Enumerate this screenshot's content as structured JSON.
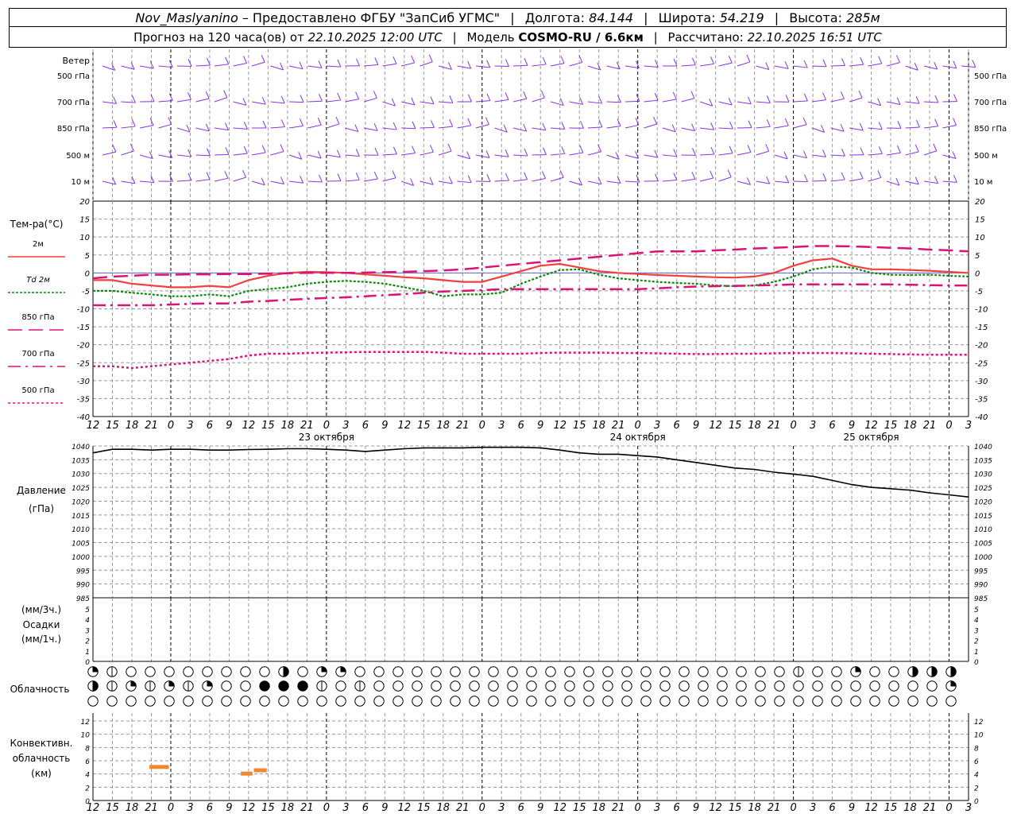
{
  "header": {
    "station": "Nov_Maslyanino",
    "provider": "– Предоставлено ФГБУ \"ЗапСиб УГМС\"",
    "lon_label": "Долгота:",
    "lon": "84.144",
    "lat_label": "Широта:",
    "lat": "54.219",
    "alt_label": "Высота:",
    "alt": "285м",
    "forecast_label": "Прогноз на 120 часа(ов) от",
    "forecast_from": "22.10.2025 12:00 UTC",
    "model_label": "Модель",
    "model": "COSMO-RU / 6.6км",
    "calc_label": "Рассчитано:",
    "calc": "22.10.2025 16:51 UTC"
  },
  "labels": {
    "wind_title": "Ветер",
    "wind_levels": [
      "500 гПа",
      "700 гПа",
      "850 гПа",
      "500 м",
      "10 м"
    ],
    "temp_title": "Тем-ра(°C)",
    "legend": [
      "2м",
      "Td  2м",
      "850 гПа",
      "700 гПа",
      "500 гПа"
    ],
    "pressure_title": "Давление",
    "pressure_unit": "(гПа)",
    "precip_unit1": "(мм/3ч.)",
    "precip_title": "Осадки",
    "precip_unit2": "(мм/1ч.)",
    "cloud_title": "Облачность",
    "conv_title1": "Конвективн.",
    "conv_title2": "облачность",
    "conv_unit": "(км)",
    "dates": [
      "23 октября",
      "24 октября",
      "25 октября"
    ]
  },
  "colors": {
    "t2m": "#f04040",
    "td2m": "#118811",
    "t850": "#dd1177",
    "t700": "#dd1177",
    "t500": "#dd1177",
    "wind": "#8833dd",
    "conv": "#ee8833",
    "grid": "#999999"
  },
  "chart_data": [
    {
      "type": "line",
      "title": "Тем-ра(°C)",
      "x_hours": [
        0,
        3,
        6,
        9,
        12,
        15,
        18,
        21,
        24,
        27,
        30,
        33,
        36,
        39,
        42,
        45,
        48,
        51,
        54,
        57,
        60,
        63,
        66,
        69,
        72,
        75,
        78,
        81,
        84,
        87,
        90,
        93,
        96,
        99,
        102,
        105,
        108,
        111,
        114,
        117,
        120,
        123,
        126,
        129,
        132,
        135
      ],
      "x_ticks": [
        "12",
        "15",
        "18",
        "21",
        "0",
        "3",
        "6",
        "9",
        "12",
        "15",
        "18",
        "21",
        "0",
        "3",
        "6",
        "9",
        "12",
        "15",
        "18",
        "21",
        "0",
        "3",
        "6",
        "9",
        "12",
        "15",
        "18"
      ],
      "ylim": [
        -40,
        20
      ],
      "series": [
        {
          "name": "2м",
          "values": [
            -2,
            -2,
            -3,
            -3.5,
            -4,
            -4,
            -3.6,
            -4,
            -2,
            -0.8,
            0,
            0.3,
            0.2,
            0,
            -0.4,
            -0.8,
            -1.2,
            -1.5,
            -2,
            -2.5,
            -2.5,
            -1,
            0.5,
            2.0,
            2.5,
            1.5,
            0.5,
            0,
            -0.3,
            -0.6,
            -0.8,
            -1,
            -1.2,
            -1.3,
            -1,
            0,
            2,
            3.5,
            4,
            2,
            1,
            1,
            0.8,
            0.6,
            0.3,
            0
          ]
        },
        {
          "name": "Td  2м",
          "values": [
            -5,
            -5,
            -5.5,
            -6,
            -6.5,
            -6.5,
            -6,
            -6.5,
            -5,
            -4.5,
            -4,
            -3,
            -2.5,
            -2.2,
            -2.5,
            -3,
            -4,
            -5,
            -6.5,
            -6,
            -6,
            -5.5,
            -3,
            -1,
            0.8,
            1,
            -0.5,
            -1.5,
            -2,
            -2.5,
            -2.8,
            -3,
            -3.5,
            -3.7,
            -3.5,
            -2.5,
            -1,
            1,
            1.8,
            1.5,
            0,
            -0.5,
            -0.6,
            -0.5,
            -0.8,
            -1
          ]
        },
        {
          "name": "850 гПа",
          "values": [
            -1.5,
            -1,
            -0.8,
            -0.5,
            -0.5,
            -0.4,
            -0.4,
            -0.3,
            -0.3,
            -0.2,
            -0.1,
            0,
            0,
            0,
            0.1,
            0.2,
            0.3,
            0.5,
            0.7,
            1.0,
            1.5,
            2,
            2.5,
            3,
            3.5,
            4,
            4.5,
            5,
            5.5,
            6,
            6,
            6,
            6.3,
            6.5,
            6.8,
            7,
            7.2,
            7.5,
            7.5,
            7.4,
            7.2,
            7,
            6.8,
            6.5,
            6.3,
            6
          ]
        },
        {
          "name": "700 гПа",
          "values": [
            -9,
            -9,
            -9,
            -9,
            -8.8,
            -8.6,
            -8.5,
            -8.5,
            -8,
            -7.8,
            -7.5,
            -7.2,
            -7,
            -6.8,
            -6.5,
            -6.2,
            -5.9,
            -5.5,
            -5.2,
            -5,
            -4.8,
            -4.5,
            -4.5,
            -4.5,
            -4.5,
            -4.5,
            -4.5,
            -4.5,
            -4.5,
            -4.3,
            -4.0,
            -3.8,
            -3.7,
            -3.6,
            -3.5,
            -3.4,
            -3.2,
            -3.2,
            -3.2,
            -3.2,
            -3.2,
            -3.2,
            -3.3,
            -3.4,
            -3.5,
            -3.5
          ]
        },
        {
          "name": "500 гПа",
          "values": [
            -26,
            -26,
            -26.5,
            -26,
            -25.5,
            -25,
            -24.5,
            -24,
            -23,
            -22.5,
            -22.5,
            -22.3,
            -22.2,
            -22.1,
            -22,
            -22,
            -22,
            -22,
            -22.2,
            -22.5,
            -22.5,
            -22.5,
            -22.5,
            -22.3,
            -22.2,
            -22.2,
            -22.2,
            -22.3,
            -22.3,
            -22.4,
            -22.5,
            -22.6,
            -22.6,
            -22.5,
            -22.5,
            -22.4,
            -22.3,
            -22.3,
            -22.3,
            -22.4,
            -22.5,
            -22.6,
            -22.7,
            -22.8,
            -22.8,
            -22.8
          ]
        }
      ],
      "yticks": [
        "20",
        "15",
        "10",
        "5",
        "0",
        "-5",
        "-10",
        "-15",
        "-20",
        "-25",
        "-30",
        "-35",
        "-40"
      ]
    },
    {
      "type": "line",
      "title": "Давление",
      "ylabel": "(гПа)",
      "ylim": [
        985,
        1040
      ],
      "yticks": [
        "1040",
        "1035",
        "1030",
        "1025",
        "1020",
        "1015",
        "1010",
        "1005",
        "1000",
        "995",
        "990",
        "985"
      ],
      "x_hours": [
        0,
        3,
        6,
        9,
        12,
        15,
        18,
        21,
        24,
        27,
        30,
        33,
        36,
        39,
        42,
        45,
        48,
        51,
        54,
        57,
        60,
        63,
        66,
        69,
        72,
        75,
        78,
        81,
        84,
        87,
        90,
        93,
        96,
        99,
        102,
        105,
        108,
        111,
        114,
        117,
        120,
        123,
        126,
        129,
        132,
        135
      ],
      "values": [
        1037.5,
        1038.8,
        1038.8,
        1038.5,
        1038.8,
        1038.8,
        1038.5,
        1038.5,
        1038.7,
        1038.8,
        1039,
        1039,
        1038.8,
        1038.5,
        1038,
        1038.5,
        1039,
        1039.3,
        1039.3,
        1039.3,
        1039.5,
        1039.5,
        1039.5,
        1039.3,
        1038.5,
        1037.5,
        1037,
        1037,
        1036.5,
        1036,
        1035,
        1034,
        1033,
        1032,
        1031.5,
        1030.5,
        1029.8,
        1029,
        1027.5,
        1026,
        1025,
        1024.5,
        1024,
        1023,
        1022.3,
        1021.5
      ]
    },
    {
      "type": "bar",
      "title": "Осадки",
      "ylim": [
        0,
        5
      ],
      "yticks": [
        "5",
        "4",
        "3",
        "2",
        "1",
        "0"
      ],
      "values": []
    },
    {
      "type": "table",
      "title": "Облачность",
      "rows": [
        [
          2,
          1,
          2,
          1,
          0,
          0,
          0,
          0,
          0,
          0,
          0,
          0,
          0,
          0,
          0,
          0,
          0,
          0,
          0,
          0,
          0,
          4,
          0,
          0,
          0,
          0,
          0,
          0,
          0,
          0,
          3,
          2,
          2,
          3,
          3,
          2,
          0,
          1,
          2,
          2,
          0,
          0,
          2,
          2,
          0,
          0,
          0,
          0,
          0,
          0,
          0,
          0,
          1,
          0,
          0,
          0,
          0,
          0,
          0,
          0,
          0,
          0,
          0,
          0,
          0,
          0,
          0,
          0,
          0,
          0,
          0,
          0,
          0,
          0,
          0,
          0,
          0,
          0,
          0,
          0,
          0,
          0,
          0,
          0,
          0,
          0,
          0,
          0,
          1,
          0,
          0,
          0,
          0,
          0,
          0,
          0,
          0,
          1,
          0,
          0,
          0,
          0,
          0,
          0,
          0,
          0,
          0,
          0,
          0,
          0,
          0,
          0,
          0,
          0,
          0,
          0,
          0,
          1,
          0,
          0,
          0,
          0,
          0,
          1,
          0,
          0,
          0,
          0,
          0,
          0,
          0,
          0,
          3,
          2,
          3,
          1,
          0,
          0,
          0,
          0,
          0,
          0,
          0,
          3,
          3,
          3,
          3,
          3,
          3,
          3,
          2,
          3,
          3
        ],
        [
          3,
          2,
          1,
          1,
          1,
          2,
          2,
          1,
          2,
          1,
          2,
          4,
          4,
          2,
          3,
          2,
          1,
          2,
          2,
          2,
          2,
          1,
          1,
          0,
          0,
          1,
          0,
          1,
          4,
          4,
          4,
          4,
          4,
          4,
          4,
          4,
          4,
          4,
          3,
          1,
          0,
          0,
          0,
          0,
          2,
          2,
          1,
          1,
          1,
          0,
          0,
          0,
          0,
          0,
          0,
          0,
          0,
          0,
          0,
          0,
          0,
          0,
          0,
          0,
          0,
          0,
          0,
          0,
          0,
          0,
          0,
          0,
          0,
          0,
          0,
          0,
          0,
          0,
          0,
          0,
          0,
          0,
          0,
          0,
          0,
          0,
          0,
          0,
          0,
          0,
          0,
          0,
          0,
          0,
          0,
          0,
          0,
          0,
          0,
          0,
          0,
          0,
          0,
          0,
          0,
          0,
          0,
          0,
          0,
          0,
          0,
          0,
          0,
          0,
          0,
          0,
          0,
          0,
          0,
          0,
          0,
          0,
          0,
          0,
          0,
          0,
          0,
          0,
          0,
          0,
          0,
          0,
          0,
          0,
          0,
          0,
          0,
          0,
          0,
          0,
          0,
          0,
          0,
          0,
          0,
          0,
          0,
          0,
          4,
          2,
          1,
          2,
          4
        ],
        [
          0,
          0,
          0,
          0,
          0,
          0,
          0,
          0,
          0,
          0,
          0,
          0,
          0,
          0,
          0,
          0,
          0,
          0,
          0,
          0,
          0,
          0,
          0,
          0,
          0,
          0,
          0,
          0,
          0,
          0,
          0,
          0,
          0,
          0,
          0,
          0,
          0,
          0,
          0,
          0,
          0,
          0,
          0,
          0,
          0,
          0,
          0,
          0,
          0,
          0,
          0,
          0,
          0,
          0,
          0,
          0,
          0,
          0,
          0,
          0,
          0,
          0,
          0,
          0,
          0,
          0,
          0,
          0,
          0,
          0,
          0,
          0,
          0,
          0,
          0,
          0,
          0,
          0,
          0,
          0,
          0,
          0,
          0,
          0,
          0,
          0,
          0,
          0,
          0,
          0,
          0,
          0,
          0,
          0,
          0,
          0,
          0,
          0,
          0,
          0,
          0,
          0,
          0,
          0,
          0,
          0,
          0,
          0,
          0,
          0,
          0,
          0,
          0,
          0,
          0,
          0,
          0,
          0,
          0,
          0,
          0,
          0,
          0,
          0,
          0,
          0,
          0,
          0,
          0,
          0,
          0,
          0,
          0,
          0,
          0,
          0,
          0,
          0,
          0,
          0,
          0,
          0,
          0,
          0,
          0,
          0,
          0,
          0,
          0,
          0,
          0,
          0,
          0
        ]
      ]
    },
    {
      "type": "bar",
      "title": "Конвективн. облачность (км)",
      "ylim": [
        0,
        13
      ],
      "yticks": [
        "12",
        "10",
        "8",
        "6",
        "4",
        "2",
        "0"
      ],
      "segments": [
        {
          "from_h": 8.7,
          "to_h": 11.7,
          "km": 5
        },
        {
          "from_h": 22.8,
          "to_h": 24.6,
          "km": 4
        },
        {
          "from_h": 24.8,
          "to_h": 26.8,
          "km": 4.5
        }
      ]
    }
  ]
}
